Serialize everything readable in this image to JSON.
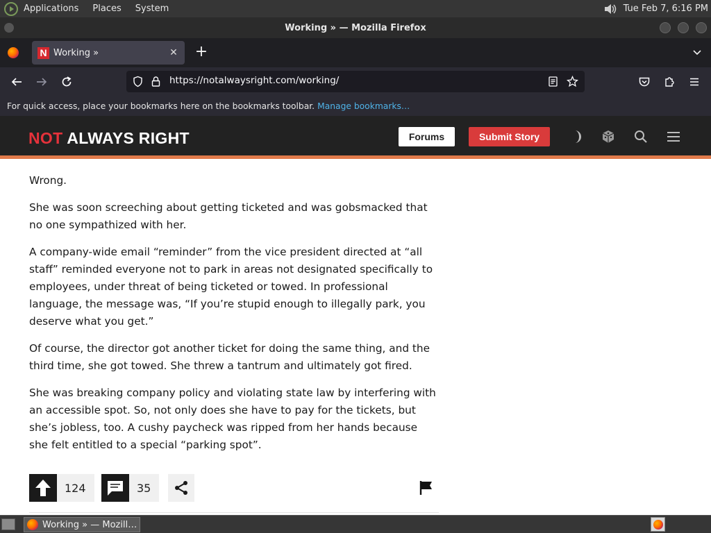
{
  "top_panel": {
    "menus": [
      "Applications",
      "Places",
      "System"
    ],
    "clock": "Tue Feb  7,  6:16 PM"
  },
  "window": {
    "title": "Working » — Mozilla Firefox"
  },
  "browser": {
    "tab": {
      "favicon_letter": "N",
      "title": "Working »",
      "close_glyph": "✕"
    },
    "new_tab_glyph": "+",
    "url": "https://notalwaysright.com/working/",
    "bookmarks_text": "For quick access, place your bookmarks here on the bookmarks toolbar.",
    "bookmarks_link": "Manage bookmarks…"
  },
  "site": {
    "logo_not": "NOT",
    "logo_rest": " ALWAYS RIGHT",
    "forums_label": "Forums",
    "submit_label": "Submit Story"
  },
  "article": {
    "paragraphs": [
      "Wrong.",
      "She was soon screeching about getting ticketed and was gobsmacked that no one sympathized with her.",
      "A company-wide email “reminder” from the vice president directed at “all staff” reminded everyone not to park in areas not designated specifically to employees, under threat of being ticketed or towed. In professional language, the message was, “If you’re stupid enough to illegally park, you deserve what you get.”",
      "Of course, the director got another ticket for doing the same thing, and the third time, she got towed. She threw a tantrum and ultimately got fired.",
      "She was breaking company policy and violating state law by interfering with an accessible spot. So, not only does she have to pay for the tickets, but she’s jobless, too. A cushy paycheck was ripped from her hands because she felt entitled to a special “parking spot”."
    ]
  },
  "actions": {
    "upvotes": "124",
    "comments": "35"
  },
  "taskbar": {
    "task_label": "Working » — Mozill…"
  },
  "colors": {
    "brand_red": "#e5323b",
    "submit_red": "#d93b3b",
    "header_bg": "#222222",
    "accent_orange": "#e07a4a",
    "link_blue": "#4fb3e8"
  }
}
